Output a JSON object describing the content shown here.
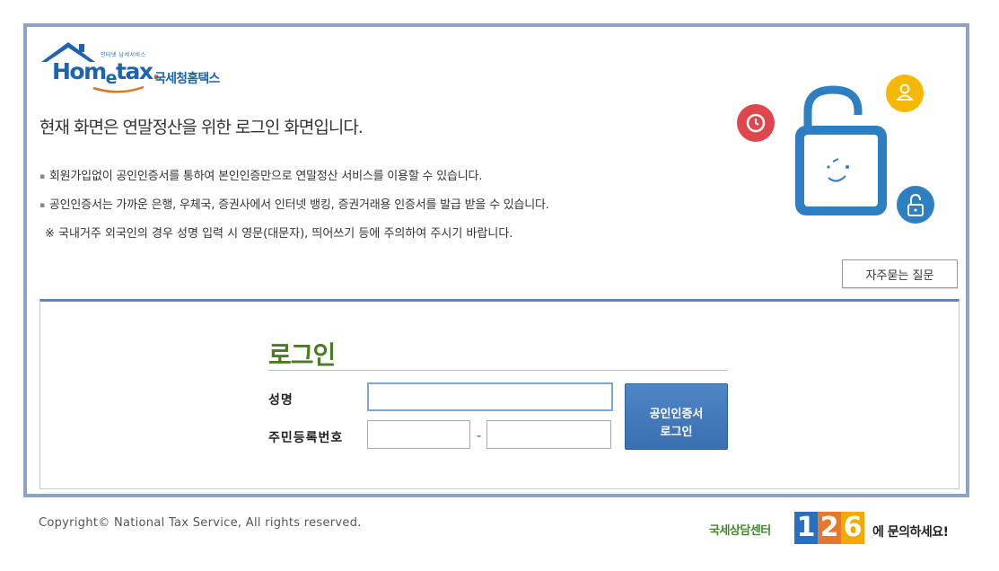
{
  "logo": {
    "small_text": "인터넷 납세서비스",
    "wordmark_pre": "Hom",
    "wordmark_e": "e",
    "wordmark_post": "tax",
    "wordmark_dot": ".",
    "korean_name": "국세청홈택스",
    "brand_color": "#1f63ae"
  },
  "headline": "현재 화면은 연말정산을 위한 로그인 화면입니다.",
  "bullets": [
    "회원가입없이 공인인증서를 통하여 본인인증만으로 연말정산 서비스를 이용할 수 있습니다.",
    "공인인증서는 가까운 은행, 우체국, 증권사에서 인터넷 뱅킹, 증권거래용 인증서를 발급 받을 수 있습니다."
  ],
  "bullet_marker": "▪",
  "note": "※ 국내거주 외국인의 경우 성명 입력 시 영문(대문자), 띄어쓰기 등에 주의하여 주시기 바랍니다.",
  "faq_button": "자주묻는 질문",
  "illustration": {
    "icons": [
      "clock-icon",
      "user-icon",
      "lock-icon",
      "padlock-icon"
    ],
    "colors": {
      "red": "#e0474c",
      "yellow": "#f5b800",
      "blue": "#2d7fc1"
    }
  },
  "login": {
    "title": "로그인",
    "name_label": "성명",
    "rrn_label": "주민등록번호",
    "name_value": "",
    "rrn_front_value": "",
    "rrn_back_value": "",
    "separator": "-",
    "cert_button_line1": "공인인증서",
    "cert_button_line2": "로그인",
    "title_color": "#4a7d22"
  },
  "footer": {
    "copyright": "Copyright© National Tax Service, All rights reserved.",
    "center_text": "국세상담센터",
    "digits": [
      "1",
      "2",
      "6"
    ],
    "digit_colors": [
      "#2a6fbf",
      "#e8772e",
      "#f2a900"
    ],
    "cta": "에 문의하세요!"
  }
}
